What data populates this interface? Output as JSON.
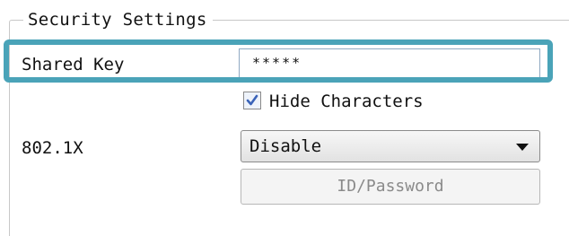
{
  "group": {
    "title": "Security Settings"
  },
  "shared_key": {
    "label": "Shared Key",
    "value": "*****"
  },
  "hide_characters": {
    "label": "Hide Characters",
    "checked": true
  },
  "dot1x": {
    "label": "802.1X",
    "selected": "Disable"
  },
  "id_password_button": {
    "label": "ID/Password",
    "enabled": false
  },
  "colors": {
    "highlight": "#4aa3b8",
    "disabled_text": "#8a8a8a"
  }
}
